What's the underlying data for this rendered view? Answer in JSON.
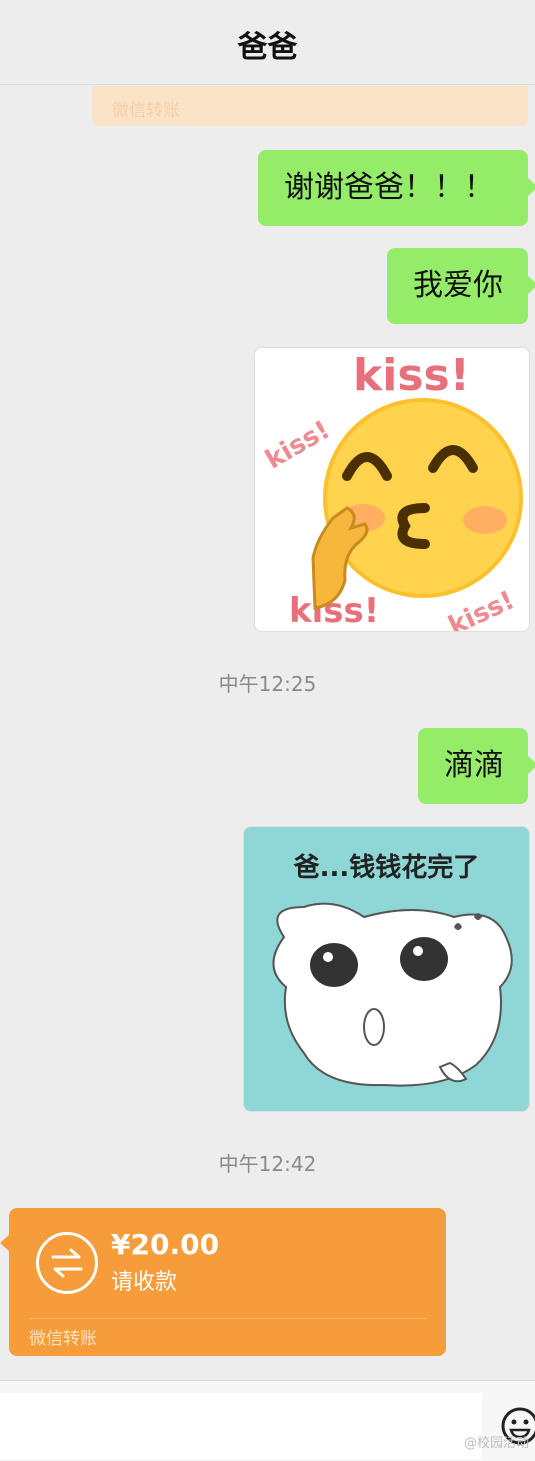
{
  "header": {
    "title": "爸爸"
  },
  "previous_transfer": {
    "label": "微信转账"
  },
  "messages": {
    "thanks": "谢谢爸爸！！！",
    "love": "我爱你",
    "didi": "滴滴"
  },
  "sticker_kiss": {
    "labels": [
      "kiss!",
      "kiss!",
      "kiss!",
      "kiss!"
    ]
  },
  "timestamps": {
    "first": "中午12:25",
    "second": "中午12:42"
  },
  "sticker_dog": {
    "caption": "爸...钱钱花完了"
  },
  "transfer": {
    "amount": "¥20.00",
    "status": "请收款",
    "footer": "微信转账",
    "color": "#f79c3a"
  },
  "input_bar": {
    "emoji_icon": "emoji-icon"
  },
  "watermark": "@校园活动"
}
